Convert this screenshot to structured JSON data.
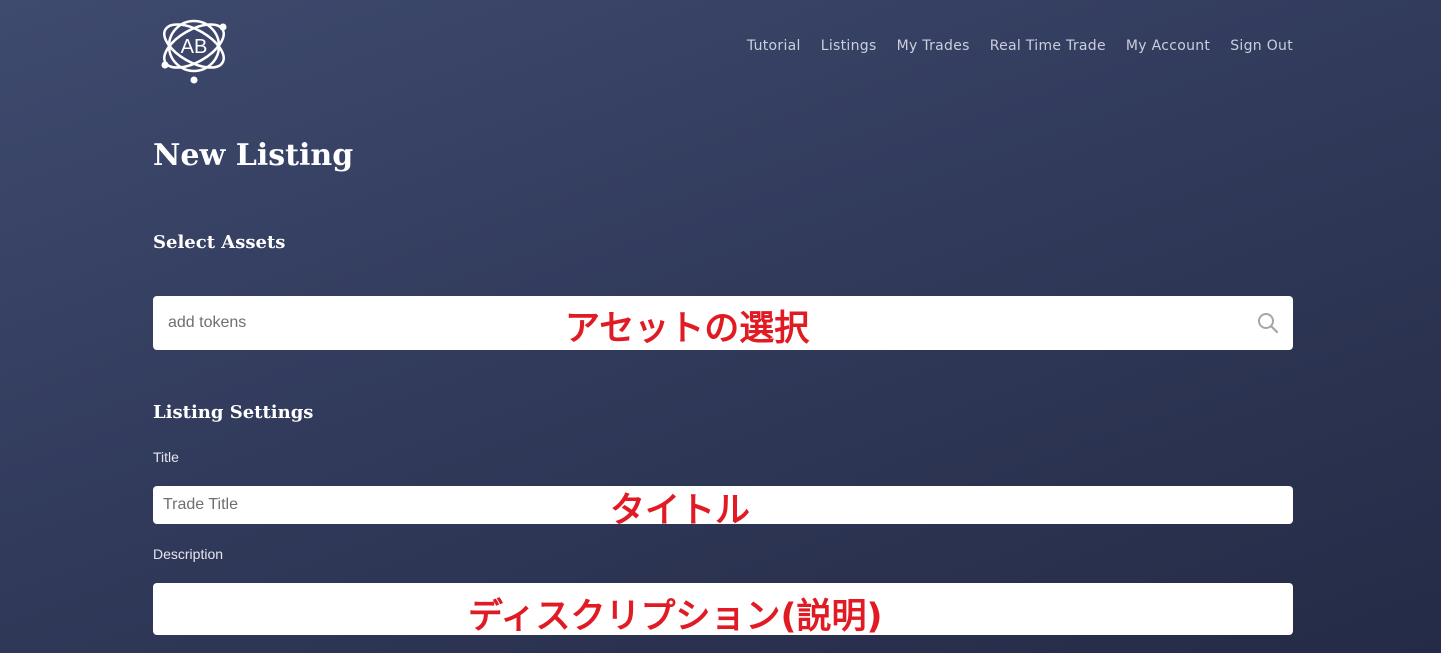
{
  "logo": {
    "text": "AB",
    "icon": "atom-logo-icon"
  },
  "nav": {
    "items": [
      {
        "label": "Tutorial"
      },
      {
        "label": "Listings"
      },
      {
        "label": "My Trades"
      },
      {
        "label": "Real Time Trade"
      },
      {
        "label": "My Account"
      },
      {
        "label": "Sign Out"
      }
    ]
  },
  "page": {
    "title": "New Listing"
  },
  "select_assets": {
    "heading": "Select Assets",
    "search": {
      "placeholder": "add tokens",
      "value": "",
      "icon": "search-icon"
    },
    "annotation": "アセットの選択"
  },
  "listing_settings": {
    "heading": "Listing Settings",
    "title_field": {
      "label": "Title",
      "placeholder": "Trade Title",
      "value": "",
      "annotation": "タイトル"
    },
    "description_field": {
      "label": "Description",
      "placeholder": "",
      "value": "",
      "annotation": "ディスクリプション(説明)"
    }
  },
  "colors": {
    "background_top": "#3e4a6e",
    "background_bottom": "#242b46",
    "annotation_red": "#e01b24",
    "nav_text": "#c9cfdd"
  }
}
